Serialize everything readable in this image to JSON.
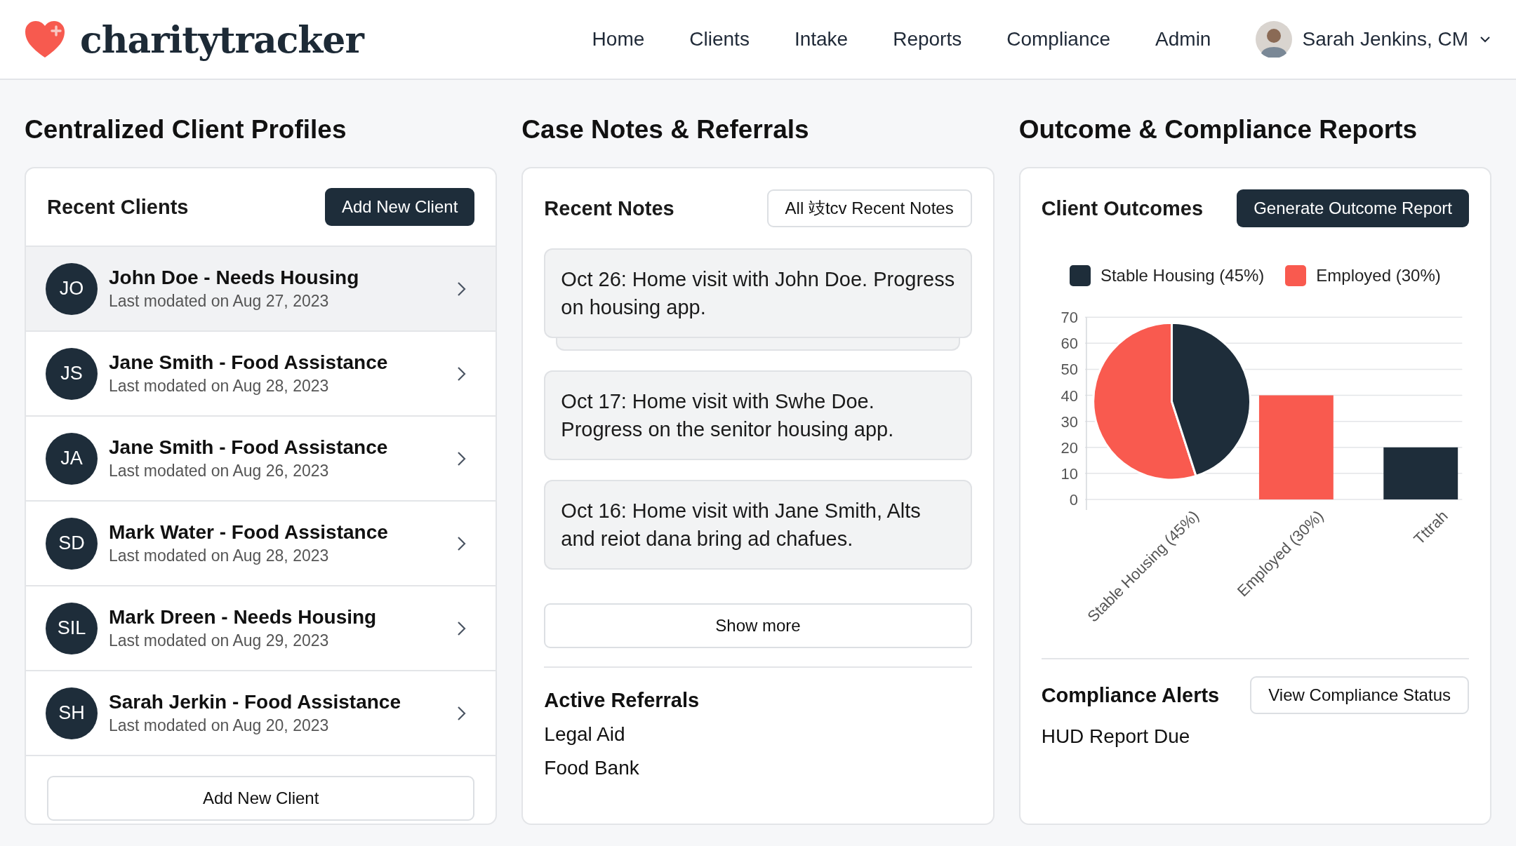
{
  "header": {
    "logo": "charitytracker",
    "nav": [
      {
        "label": "Home"
      },
      {
        "label": "Clients"
      },
      {
        "label": "Intake"
      },
      {
        "label": "Reports"
      },
      {
        "label": "Compliance"
      },
      {
        "label": "Admin"
      }
    ],
    "user": "Sarah Jenkins, CM"
  },
  "profiles": {
    "title": "Centralized Client Profiles",
    "card_title": "Recent Clients",
    "add_button": "Add New Client",
    "clients": [
      {
        "initials": "JO",
        "name": "John Doe - Needs Housing",
        "modified": "Last modated on Aug 27, 2023",
        "selected": true
      },
      {
        "initials": "JS",
        "name": "Jane Smith - Food Assistance",
        "modified": "Last modated on Aug 28, 2023",
        "selected": false
      },
      {
        "initials": "JA",
        "name": "Jane Smith - Food Assistance",
        "modified": "Last modated on Aug 26, 2023",
        "selected": false
      },
      {
        "initials": "SD",
        "name": "Mark Water - Food Assistance",
        "modified": "Last modated on Aug 28, 2023",
        "selected": false
      },
      {
        "initials": "SIL",
        "name": "Mark Dreen - Needs Housing",
        "modified": "Last modated on Aug 29, 2023",
        "selected": false
      },
      {
        "initials": "SH",
        "name": "Sarah Jerkin - Food Assistance",
        "modified": "Last modated on Aug 20, 2023",
        "selected": false
      }
    ],
    "bottom_button": "Add New Client"
  },
  "notes": {
    "title": "Case Notes & Referrals",
    "card_title": "Recent Notes",
    "all_button": "All 攱tcv Recent Notes",
    "items": [
      {
        "text": "Oct 26: Home visit with John Doe. Progress on housing app.",
        "stacked": true
      },
      {
        "text": "Oct 17: Home visit with Swhe Doe. Progress on the senitor housing app.",
        "stacked": false
      },
      {
        "text": "Oct 16: Home visit with Jane Smith, Alts and reiot dana bring ad chafues.",
        "stacked": false
      }
    ],
    "show_more": "Show more",
    "referrals_title": "Active Referrals",
    "referrals": [
      "Legal Aid",
      "Food Bank"
    ]
  },
  "reports": {
    "title": "Outcome & Compliance Reports",
    "card_title": "Client Outcomes",
    "generate_button": "Generate Outcome Report",
    "chart_data": {
      "type": "bar",
      "categories": [
        "Stable Housing (45%)",
        "Employed (30%)",
        "Tttrah"
      ],
      "series": [
        {
          "name": "Stable Housing (45%)",
          "color": "#1e2d3a",
          "values": [
            null,
            null,
            20
          ]
        },
        {
          "name": "Employed (30%)",
          "color": "#f95a4f",
          "values": [
            null,
            40,
            null
          ]
        }
      ],
      "ylim": [
        0,
        70
      ],
      "grid": true,
      "yticks": [
        0,
        10,
        20,
        30,
        40,
        50,
        60,
        70
      ]
    },
    "alerts_title": "Compliance Alerts",
    "alerts_button": "View Compliance Status",
    "alerts": [
      "HUD Report Due"
    ]
  }
}
